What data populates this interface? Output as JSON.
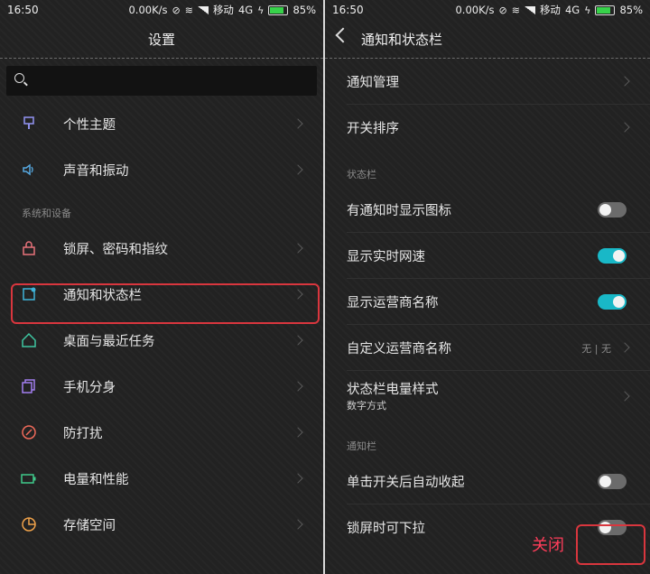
{
  "left": {
    "status": {
      "time": "16:50",
      "speed": "0.00K/s",
      "carrier": "移动",
      "network": "4G",
      "battery": "85%"
    },
    "title": "设置",
    "search": {
      "placeholder": ""
    },
    "items_top": [
      {
        "label": "个性主题",
        "icon": "theme-icon",
        "color": "#8d8ee8"
      },
      {
        "label": "声音和振动",
        "icon": "speaker-icon",
        "color": "#56a8e0"
      }
    ],
    "section_label": "系统和设备",
    "items": [
      {
        "label": "锁屏、密码和指纹",
        "icon": "lock-icon",
        "color": "#e8727a"
      },
      {
        "label": "通知和状态栏",
        "icon": "notification-icon",
        "color": "#3fb3d9"
      },
      {
        "label": "桌面与最近任务",
        "icon": "home-icon",
        "color": "#3ec7a2"
      },
      {
        "label": "手机分身",
        "icon": "clone-icon",
        "color": "#a27ef0"
      },
      {
        "label": "防打扰",
        "icon": "dnd-icon",
        "color": "#f06a5a"
      },
      {
        "label": "电量和性能",
        "icon": "battery-icon",
        "color": "#3fc98a"
      },
      {
        "label": "存储空间",
        "icon": "storage-icon",
        "color": "#f0a24a"
      }
    ]
  },
  "right": {
    "status": {
      "time": "16:50",
      "speed": "0.00K/s",
      "carrier": "移动",
      "network": "4G",
      "battery": "85%"
    },
    "title": "通知和状态栏",
    "items_top": [
      {
        "label": "通知管理"
      },
      {
        "label": "开关排序"
      }
    ],
    "section_status": "状态栏",
    "status_items": [
      {
        "label": "有通知时显示图标",
        "toggle": false
      },
      {
        "label": "显示实时网速",
        "toggle": true
      },
      {
        "label": "显示运营商名称",
        "toggle": true
      }
    ],
    "carrier_name": {
      "label": "自定义运营商名称",
      "value": "无 | 无"
    },
    "battery_style": {
      "label": "状态栏电量样式",
      "sub": "数字方式"
    },
    "section_notify": "通知栏",
    "notify_items": [
      {
        "label": "单击开关后自动收起",
        "toggle": false
      },
      {
        "label": "锁屏时可下拉",
        "toggle": false
      }
    ],
    "annotation": "关闭"
  },
  "colors": {
    "accent": "#19b8c7",
    "highlight": "#d9363e",
    "annotation": "#ff3d5a"
  }
}
